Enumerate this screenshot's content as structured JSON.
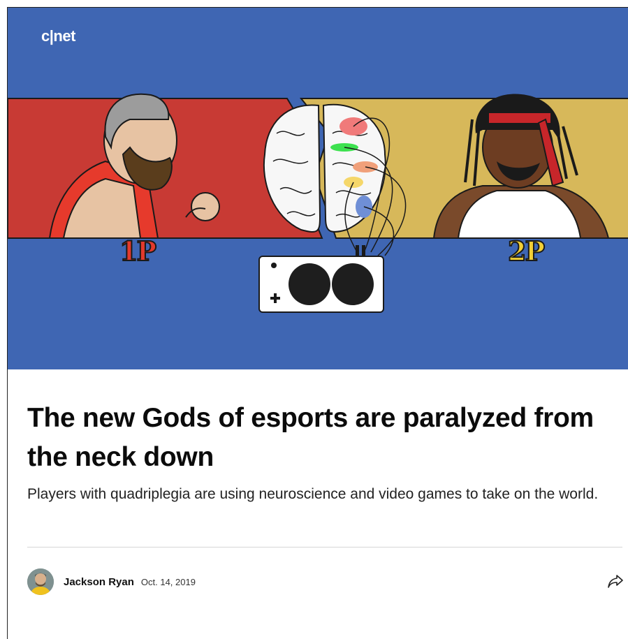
{
  "brand": {
    "logo_text": "c|net"
  },
  "hero": {
    "player1_tag": "1P",
    "player2_tag": "2P",
    "colors": {
      "background": "#3f66b3",
      "left_panel": "#c83a34",
      "right_panel": "#d7b85a"
    }
  },
  "article": {
    "title": "The new Gods of esports are paralyzed from the neck down",
    "subtitle": "Players with quadriplegia are using neuroscience and video games to take on the world."
  },
  "byline": {
    "author": "Jackson Ryan",
    "date": "Oct. 14, 2019"
  },
  "icons": {
    "share": "share-arrow-icon",
    "avatar": "author-avatar"
  }
}
